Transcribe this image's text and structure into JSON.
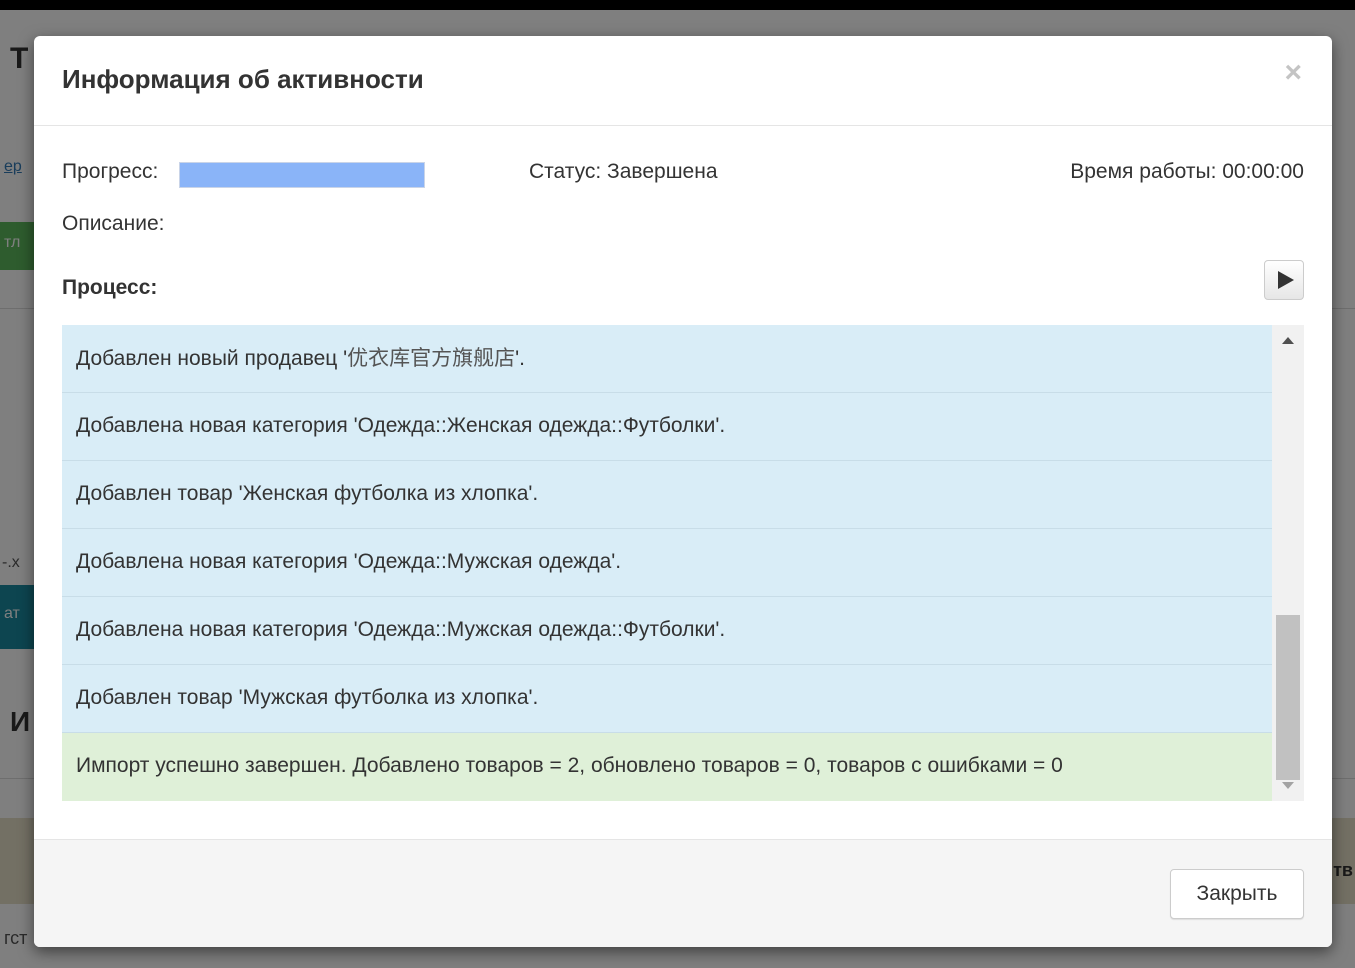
{
  "modal": {
    "title": "Информация об активности",
    "close_glyph": "×",
    "progress_label": "Прогресс:",
    "progress_value": 1.0,
    "status": "Статус: Завершена",
    "work_time": "Время работы: 00:00:00",
    "description_label": "Описание:",
    "process_label": "Процесс:",
    "play_icon": "play-icon",
    "log": [
      {
        "prefix": "Добавлен новый продавец '",
        "cjk": "优衣库官方旗舰店",
        "suffix": "'.",
        "type": "info"
      },
      {
        "text": "Добавлена новая категория 'Одежда::Женская одежда::Футболки'.",
        "type": "info"
      },
      {
        "text": "Добавлен товар 'Женская футболка из хлопка'.",
        "type": "info"
      },
      {
        "text": "Добавлена новая категория 'Одежда::Мужская одежда'.",
        "type": "info"
      },
      {
        "text": "Добавлена новая категория 'Одежда::Мужская одежда::Футболки'.",
        "type": "info"
      },
      {
        "text": "Добавлен товар 'Мужская футболка из хлопка'.",
        "type": "info"
      },
      {
        "text": "Импорт успешно завершен. Добавлено товаров = 2, обновлено товаров = 0, товаров с ошибками = 0",
        "type": "success"
      }
    ],
    "footer": {
      "close_button": "Закрыть"
    }
  },
  "background": {
    "fragments": [
      "Т",
      "ер",
      "тл",
      "-.х",
      "ат",
      "И",
      "тв",
      "гст"
    ]
  },
  "colors": {
    "info_row": "#d9edf7",
    "success_row": "#dff0d8",
    "progress_fill": "#8ab4f8"
  }
}
